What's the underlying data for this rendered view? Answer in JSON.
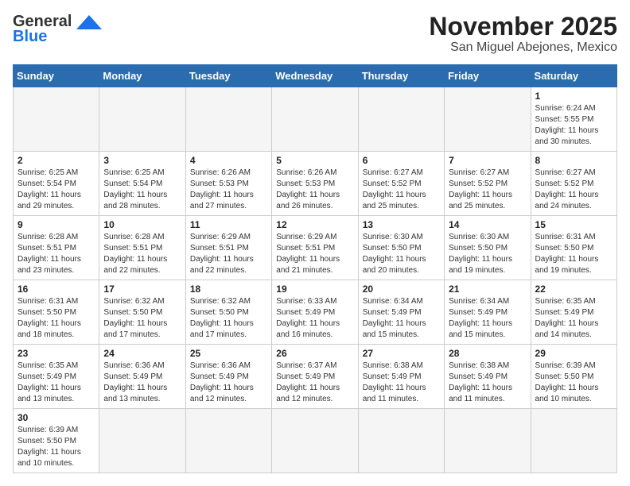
{
  "header": {
    "logo_line1": "General",
    "logo_line2": "Blue",
    "month_title": "November 2025",
    "location": "San Miguel Abejones, Mexico"
  },
  "weekdays": [
    "Sunday",
    "Monday",
    "Tuesday",
    "Wednesday",
    "Thursday",
    "Friday",
    "Saturday"
  ],
  "weeks": [
    [
      {
        "day": "",
        "info": ""
      },
      {
        "day": "",
        "info": ""
      },
      {
        "day": "",
        "info": ""
      },
      {
        "day": "",
        "info": ""
      },
      {
        "day": "",
        "info": ""
      },
      {
        "day": "",
        "info": ""
      },
      {
        "day": "1",
        "info": "Sunrise: 6:24 AM\nSunset: 5:55 PM\nDaylight: 11 hours and 30 minutes."
      }
    ],
    [
      {
        "day": "2",
        "info": "Sunrise: 6:25 AM\nSunset: 5:54 PM\nDaylight: 11 hours and 29 minutes."
      },
      {
        "day": "3",
        "info": "Sunrise: 6:25 AM\nSunset: 5:54 PM\nDaylight: 11 hours and 28 minutes."
      },
      {
        "day": "4",
        "info": "Sunrise: 6:26 AM\nSunset: 5:53 PM\nDaylight: 11 hours and 27 minutes."
      },
      {
        "day": "5",
        "info": "Sunrise: 6:26 AM\nSunset: 5:53 PM\nDaylight: 11 hours and 26 minutes."
      },
      {
        "day": "6",
        "info": "Sunrise: 6:27 AM\nSunset: 5:52 PM\nDaylight: 11 hours and 25 minutes."
      },
      {
        "day": "7",
        "info": "Sunrise: 6:27 AM\nSunset: 5:52 PM\nDaylight: 11 hours and 25 minutes."
      },
      {
        "day": "8",
        "info": "Sunrise: 6:27 AM\nSunset: 5:52 PM\nDaylight: 11 hours and 24 minutes."
      }
    ],
    [
      {
        "day": "9",
        "info": "Sunrise: 6:28 AM\nSunset: 5:51 PM\nDaylight: 11 hours and 23 minutes."
      },
      {
        "day": "10",
        "info": "Sunrise: 6:28 AM\nSunset: 5:51 PM\nDaylight: 11 hours and 22 minutes."
      },
      {
        "day": "11",
        "info": "Sunrise: 6:29 AM\nSunset: 5:51 PM\nDaylight: 11 hours and 22 minutes."
      },
      {
        "day": "12",
        "info": "Sunrise: 6:29 AM\nSunset: 5:51 PM\nDaylight: 11 hours and 21 minutes."
      },
      {
        "day": "13",
        "info": "Sunrise: 6:30 AM\nSunset: 5:50 PM\nDaylight: 11 hours and 20 minutes."
      },
      {
        "day": "14",
        "info": "Sunrise: 6:30 AM\nSunset: 5:50 PM\nDaylight: 11 hours and 19 minutes."
      },
      {
        "day": "15",
        "info": "Sunrise: 6:31 AM\nSunset: 5:50 PM\nDaylight: 11 hours and 19 minutes."
      }
    ],
    [
      {
        "day": "16",
        "info": "Sunrise: 6:31 AM\nSunset: 5:50 PM\nDaylight: 11 hours and 18 minutes."
      },
      {
        "day": "17",
        "info": "Sunrise: 6:32 AM\nSunset: 5:50 PM\nDaylight: 11 hours and 17 minutes."
      },
      {
        "day": "18",
        "info": "Sunrise: 6:32 AM\nSunset: 5:50 PM\nDaylight: 11 hours and 17 minutes."
      },
      {
        "day": "19",
        "info": "Sunrise: 6:33 AM\nSunset: 5:49 PM\nDaylight: 11 hours and 16 minutes."
      },
      {
        "day": "20",
        "info": "Sunrise: 6:34 AM\nSunset: 5:49 PM\nDaylight: 11 hours and 15 minutes."
      },
      {
        "day": "21",
        "info": "Sunrise: 6:34 AM\nSunset: 5:49 PM\nDaylight: 11 hours and 15 minutes."
      },
      {
        "day": "22",
        "info": "Sunrise: 6:35 AM\nSunset: 5:49 PM\nDaylight: 11 hours and 14 minutes."
      }
    ],
    [
      {
        "day": "23",
        "info": "Sunrise: 6:35 AM\nSunset: 5:49 PM\nDaylight: 11 hours and 13 minutes."
      },
      {
        "day": "24",
        "info": "Sunrise: 6:36 AM\nSunset: 5:49 PM\nDaylight: 11 hours and 13 minutes."
      },
      {
        "day": "25",
        "info": "Sunrise: 6:36 AM\nSunset: 5:49 PM\nDaylight: 11 hours and 12 minutes."
      },
      {
        "day": "26",
        "info": "Sunrise: 6:37 AM\nSunset: 5:49 PM\nDaylight: 11 hours and 12 minutes."
      },
      {
        "day": "27",
        "info": "Sunrise: 6:38 AM\nSunset: 5:49 PM\nDaylight: 11 hours and 11 minutes."
      },
      {
        "day": "28",
        "info": "Sunrise: 6:38 AM\nSunset: 5:49 PM\nDaylight: 11 hours and 11 minutes."
      },
      {
        "day": "29",
        "info": "Sunrise: 6:39 AM\nSunset: 5:50 PM\nDaylight: 11 hours and 10 minutes."
      }
    ],
    [
      {
        "day": "30",
        "info": "Sunrise: 6:39 AM\nSunset: 5:50 PM\nDaylight: 11 hours and 10 minutes."
      },
      {
        "day": "",
        "info": ""
      },
      {
        "day": "",
        "info": ""
      },
      {
        "day": "",
        "info": ""
      },
      {
        "day": "",
        "info": ""
      },
      {
        "day": "",
        "info": ""
      },
      {
        "day": "",
        "info": ""
      }
    ]
  ]
}
